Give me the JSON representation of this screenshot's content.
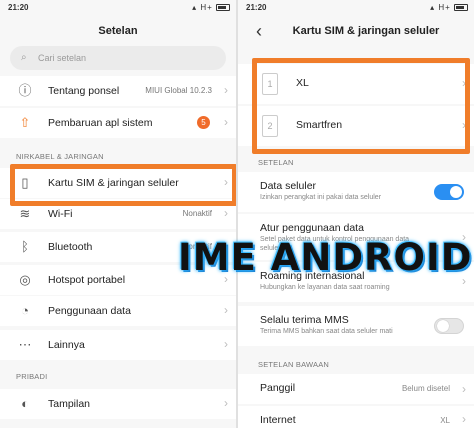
{
  "colors": {
    "accent": "#f07d2a",
    "toggle_on": "#2a8ff2",
    "badge": "#f06b2a"
  },
  "left": {
    "status": {
      "time": "21:20",
      "icons": "H+"
    },
    "title": "Setelan",
    "search": {
      "placeholder": "Cari setelan",
      "icon": "search-icon"
    },
    "items": [
      {
        "icon": "info-icon",
        "label": "Tentang ponsel",
        "value": "MIUI Global 10.2.3"
      },
      {
        "icon": "update-icon",
        "label": "Pembaruan apl sistem",
        "badge": "5"
      }
    ],
    "section_network": "NIRKABEL & JARINGAN",
    "network_items": [
      {
        "icon": "sim-card-icon",
        "label": "Kartu SIM & jaringan seluler"
      },
      {
        "icon": "wifi-icon",
        "label": "Wi-Fi",
        "value": "Nonaktif"
      },
      {
        "icon": "bluetooth-icon",
        "label": "Bluetooth",
        "value": "Nonaktif"
      },
      {
        "icon": "hotspot-icon",
        "label": "Hotspot portabel"
      },
      {
        "icon": "data-usage-icon",
        "label": "Penggunaan data"
      },
      {
        "icon": "more-icon",
        "label": "Lainnya"
      }
    ],
    "section_personal": "PRIBADI",
    "personal_items": [
      {
        "icon": "display-icon",
        "label": "Tampilan"
      }
    ]
  },
  "right": {
    "status": {
      "time": "21:20",
      "icons": "H+"
    },
    "title": "Kartu SIM & jaringan seluler",
    "sims": [
      {
        "slot": "1",
        "name": "XL"
      },
      {
        "slot": "2",
        "name": "Smartfren"
      }
    ],
    "section_settings": "SETELAN",
    "mobile_data": {
      "label": "Data seluler",
      "sub": "Izinkan perangkat ini pakai data seluler",
      "on": true
    },
    "usage": {
      "label": "Atur penggunaan data",
      "sub1": "Setel paket data untuk kontrol penggunaan data",
      "sub2": "seluler"
    },
    "roaming": {
      "label": "Roaming internasional",
      "sub": "Hubungkan ke layanan data saat roaming"
    },
    "mms": {
      "label": "Selalu terima MMS",
      "sub": "Terima MMS bahkan saat data seluler mati",
      "on": false
    },
    "section_default": "SETELAN BAWAAN",
    "calls": {
      "label": "Panggil",
      "value": "Belum disetel"
    },
    "internet": {
      "label": "Internet",
      "value": "XL"
    }
  },
  "watermark": "IME ANDROID"
}
